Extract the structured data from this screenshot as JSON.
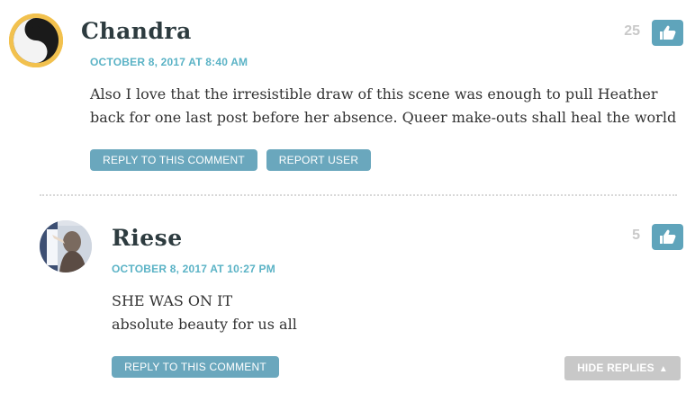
{
  "comments": [
    {
      "author": "Chandra",
      "date": "OCTOBER 8, 2017 AT 8:40 AM",
      "likes": "25",
      "lines": [
        "Also I love that the irresistible draw of this scene was enough to pull Heather",
        "back for one last post before her absence. Queer make-outs shall heal the world"
      ],
      "reply_label": "REPLY TO THIS COMMENT",
      "report_label": "REPORT USER"
    },
    {
      "author": "Riese",
      "date": "OCTOBER 8, 2017 AT 10:27 PM",
      "likes": "5",
      "lines": [
        "SHE WAS ON IT",
        "absolute beauty for us all"
      ],
      "reply_label": "REPLY TO THIS COMMENT"
    }
  ],
  "hide_replies_label": "HIDE REPLIES",
  "colors": {
    "accent": "#5bb3c6",
    "button": "#6aa7bd",
    "like_button": "#5fa4bb",
    "avatar_ring": "#f2c14e"
  },
  "icons": {
    "like": "thumbs-up-icon",
    "collapse": "caret-up-icon"
  }
}
